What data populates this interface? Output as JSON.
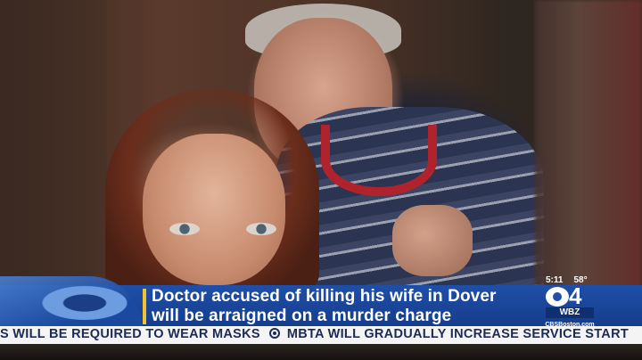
{
  "lower_third": {
    "headline_line1": "Doctor accused of killing his wife in Dover",
    "headline_line2": "will be arraigned on a murder charge",
    "accent_color": "#f2c230",
    "band_color": "#1f4fa8"
  },
  "weather": {
    "time": "5:11",
    "temperature": "58°"
  },
  "station": {
    "channel_number": "4",
    "call_letters": "WBZ",
    "website": "CBSBoston.com",
    "logo_icon": "cbs-eye-icon"
  },
  "ticker": {
    "item1": "S WILL BE REQUIRED TO WEAR MASKS",
    "item2": "MBTA WILL GRADUALLY INCREASE SERVICE START",
    "separator_icon": "cbs-eye-icon",
    "text_color": "#1c2a55"
  }
}
